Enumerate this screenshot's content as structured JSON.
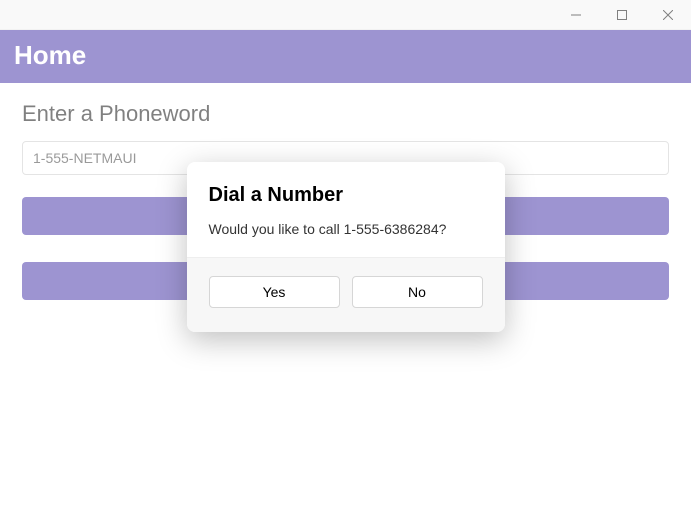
{
  "header": {
    "title": "Home"
  },
  "form": {
    "label": "Enter a Phoneword",
    "phoneword_value": "1-555-NETMAUI"
  },
  "buttons": {
    "translate": "",
    "call": ""
  },
  "dialog": {
    "title": "Dial a Number",
    "message": "Would you like to call 1-555-6386284?",
    "yes": "Yes",
    "no": "No"
  }
}
